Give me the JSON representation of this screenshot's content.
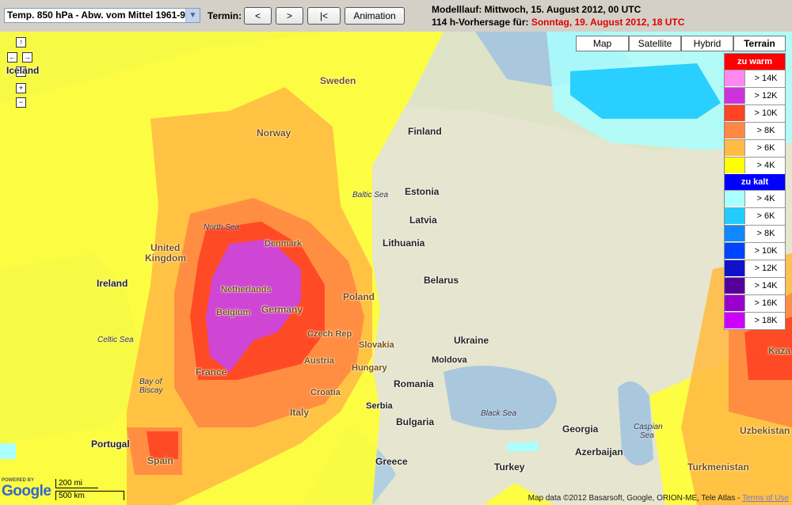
{
  "toolbar": {
    "selected_parameter": "Temp. 850 hPa - Abw. vom Mittel 1961-90",
    "termin_label": "Termin:",
    "prev_label": "<",
    "next_label": ">",
    "first_label": "|<",
    "animation_label": "Animation"
  },
  "model_info": {
    "run_label": "Modelllauf: Mittwoch, 15. August 2012, 00 UTC",
    "forecast_prefix": "114 h-Vorhersage für:",
    "forecast_date": "Sonntag, 19. August 2012, 18 UTC",
    "forecast_color": "#e00000"
  },
  "map_types": {
    "map": "Map",
    "satellite": "Satellite",
    "hybrid": "Hybrid",
    "terrain": "Terrain",
    "active": "Terrain"
  },
  "legend": {
    "warm_header": "zu warm",
    "warm_color": "#ff0000",
    "warm": [
      {
        "label": "> 14K",
        "color": "#ff88ee"
      },
      {
        "label": "> 12K",
        "color": "#cc33dd"
      },
      {
        "label": "> 10K",
        "color": "#ff4422"
      },
      {
        "label": "> 8K",
        "color": "#ff8844"
      },
      {
        "label": "> 6K",
        "color": "#ffbb44"
      },
      {
        "label": "> 4K",
        "color": "#ffff00"
      }
    ],
    "cold_header": "zu kalt",
    "cold_color": "#0000ff",
    "cold": [
      {
        "label": "> 4K",
        "color": "#aaffff"
      },
      {
        "label": "> 6K",
        "color": "#22ccff"
      },
      {
        "label": "> 8K",
        "color": "#1188ff"
      },
      {
        "label": "> 10K",
        "color": "#0044ff"
      },
      {
        "label": "> 12K",
        "color": "#1111cc"
      },
      {
        "label": "> 14K",
        "color": "#550099"
      },
      {
        "label": "> 16K",
        "color": "#9900cc"
      },
      {
        "label": "> 18K",
        "color": "#cc00ff"
      }
    ]
  },
  "places": {
    "iceland": "Iceland",
    "sweden": "Sweden",
    "norway": "Norway",
    "finland": "Finland",
    "estonia": "Estonia",
    "latvia": "Latvia",
    "lithuania": "Lithuania",
    "belarus": "Belarus",
    "denmark": "Denmark",
    "united_kingdom_1": "United",
    "united_kingdom_2": "Kingdom",
    "ireland": "Ireland",
    "netherlands": "Netherlands",
    "germany": "Germany",
    "belgium": "Belgium",
    "poland": "Poland",
    "czech": "Czech Rep",
    "slovakia": "Slovakia",
    "ukraine": "Ukraine",
    "austria": "Austria",
    "hungary": "Hungary",
    "moldova": "Moldova",
    "france": "France",
    "romania": "Romania",
    "croatia": "Croatia",
    "serbia": "Serbia",
    "bulgaria": "Bulgaria",
    "italy": "Italy",
    "portugal": "Portugal",
    "spain": "Spain",
    "greece": "Greece",
    "turkey": "Turkey",
    "georgia": "Georgia",
    "azerbaijan": "Azerbaijan",
    "uzbekistan": "Uzbekistan",
    "turkmenistan": "Turkmenistan",
    "kaza": "Kaza"
  },
  "seas": {
    "north_sea": "North Sea",
    "baltic_sea": "Baltic Sea",
    "celtic_sea": "Celtic Sea",
    "bay_1": "Bay of",
    "bay_2": "Biscay",
    "black_sea": "Black Sea",
    "caspian_1": "Caspian",
    "caspian_2": "Sea"
  },
  "footer": {
    "powered_by": "POWERED BY",
    "google": "Google",
    "scale_mi": "200 mi",
    "scale_km": "500 km",
    "copyright": "Map data ©2012 Basarsoft, Google, ORION-ME, Tele Atlas -",
    "terms": "Terms of Use"
  }
}
